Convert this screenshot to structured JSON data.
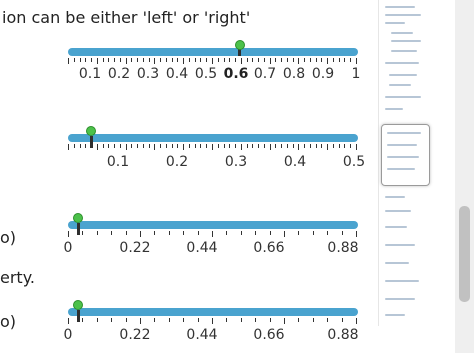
{
  "intro": {
    "line1": "ion can be either 'left' or 'right'",
    "frag2": "o)",
    "frag3": "erty.",
    "frag4": "o)"
  },
  "sliders": [
    {
      "labels": [
        "0.1",
        "0.2",
        "0.3",
        "0.4",
        "0.5",
        "0.6",
        "0.7",
        "0.8",
        "0.9",
        "1"
      ],
      "active_label": "0.6",
      "value": 0.6
    },
    {
      "labels": [
        "0.1",
        "0.2",
        "0.3",
        "0.4",
        "0.5"
      ],
      "value": 0.05
    },
    {
      "labels": [
        "0",
        "0.22",
        "0.44",
        "0.66",
        "0.88"
      ],
      "value": 0.03
    },
    {
      "labels": [
        "0",
        "0.22",
        "0.44",
        "0.66",
        "0.88"
      ],
      "value": 0.03
    }
  ],
  "colors": {
    "track": "#4aa3cf",
    "knob": "#4cc14a"
  },
  "icons": {
    "minimap": "page-minimap-icon"
  }
}
